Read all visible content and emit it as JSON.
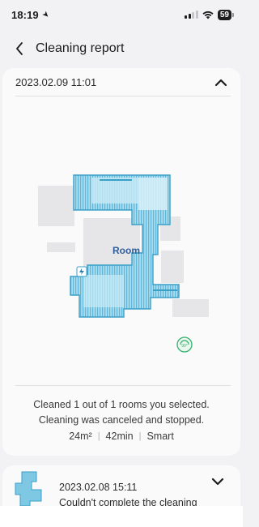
{
  "status_bar": {
    "time": "18:19",
    "battery": "59"
  },
  "header": {
    "title": "Cleaning report",
    "back_icon": "chevron-left-icon"
  },
  "report": {
    "date": "2023.02.09 11:01",
    "collapse_icon": "chevron-up-icon",
    "map": {
      "room_label": "Room",
      "dock_icon": "charging-dock-icon",
      "robot_marker": "robot-position-icon",
      "room_color": "#7ec8e3",
      "path_color": "#3aa0c8"
    },
    "summary_line1": "Cleaned 1 out of 1 rooms you selected.",
    "summary_line2": "Cleaning was canceled and stopped.",
    "stats": [
      "24m²",
      "42min",
      "Smart"
    ]
  },
  "previous_report": {
    "date": "2023.02.08 15:11",
    "message": "Couldn't complete the cleaning",
    "expand_icon": "chevron-down-icon"
  }
}
